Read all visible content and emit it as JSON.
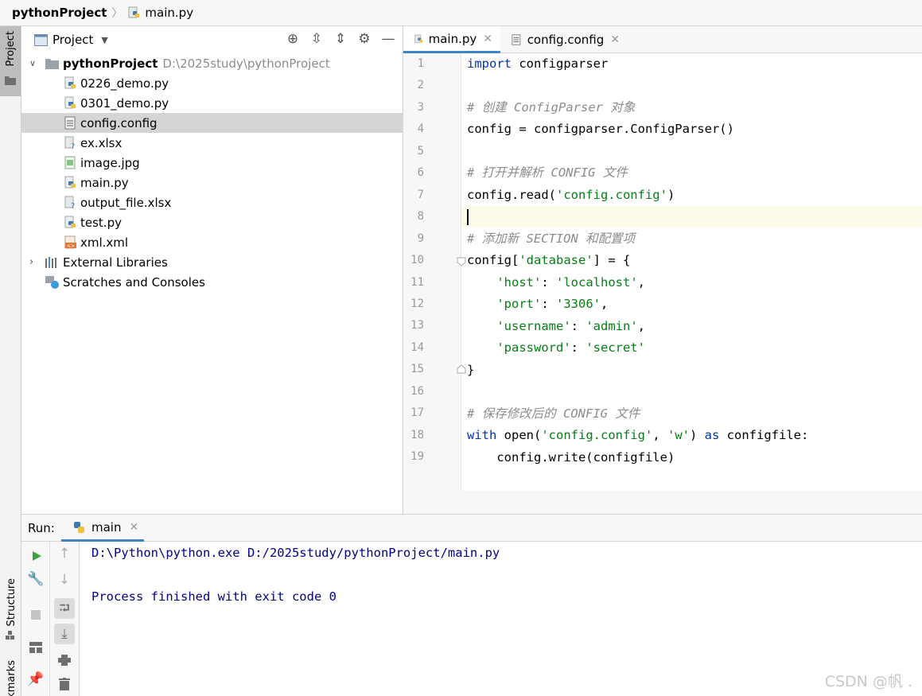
{
  "breadcrumb": {
    "project": "pythonProject",
    "file": "main.py"
  },
  "tool_windows": {
    "project": "Project",
    "structure": "Structure",
    "bookmarks": "kmarks"
  },
  "project_panel": {
    "title": "Project",
    "root": {
      "name": "pythonProject",
      "path": "D:\\2025study\\pythonProject"
    },
    "files": [
      {
        "name": "0226_demo.py",
        "type": "python"
      },
      {
        "name": "0301_demo.py",
        "type": "python"
      },
      {
        "name": "config.config",
        "type": "text",
        "selected": true
      },
      {
        "name": "ex.xlsx",
        "type": "unknown"
      },
      {
        "name": "image.jpg",
        "type": "image"
      },
      {
        "name": "main.py",
        "type": "python"
      },
      {
        "name": "output_file.xlsx",
        "type": "unknown"
      },
      {
        "name": "test.py",
        "type": "python"
      },
      {
        "name": "xml.xml",
        "type": "xml"
      }
    ],
    "external_libraries": "External Libraries",
    "scratches": "Scratches and Consoles"
  },
  "editor": {
    "tabs": [
      {
        "label": "main.py",
        "active": true
      },
      {
        "label": "config.config",
        "active": false
      }
    ],
    "line_numbers": [
      "1",
      "2",
      "3",
      "4",
      "5",
      "6",
      "7",
      "8",
      "9",
      "10",
      "11",
      "12",
      "13",
      "14",
      "15",
      "16",
      "17",
      "18",
      "19"
    ],
    "code": {
      "l1_kw": "import",
      "l1_rest": " configparser",
      "l3": "# 创建 ConfigParser 对象",
      "l4": "config = configparser.ConfigParser()",
      "l6": "# 打开并解析 CONFIG 文件",
      "l7_a": "config.read(",
      "l7_s": "'config.config'",
      "l7_b": ")",
      "l9": "# 添加新 SECTION 和配置项",
      "l10_a": "config[",
      "l10_s": "'database'",
      "l10_b": "] = {",
      "l11_k": "'host'",
      "l11_sep": ": ",
      "l11_v": "'localhost'",
      "l11_end": ",",
      "l12_k": "'port'",
      "l12_sep": ": ",
      "l12_v": "'3306'",
      "l12_end": ",",
      "l13_k": "'username'",
      "l13_sep": ": ",
      "l13_v": "'admin'",
      "l13_end": ",",
      "l14_k": "'password'",
      "l14_sep": ": ",
      "l14_v": "'secret'",
      "l15": "}",
      "l17": "# 保存修改后的 CONFIG 文件",
      "l18_kw1": "with",
      "l18_a": " open(",
      "l18_s1": "'config.config'",
      "l18_b": ", ",
      "l18_s2": "'w'",
      "l18_c": ") ",
      "l18_kw2": "as",
      "l18_d": " configfile:",
      "l19": "    config.write(configfile)"
    }
  },
  "run_panel": {
    "label": "Run:",
    "tab": "main",
    "output": [
      "D:\\Python\\python.exe D:/2025study/pythonProject/main.py",
      "",
      "Process finished with exit code 0"
    ]
  },
  "watermark": "CSDN @帆 .",
  "colors": {
    "keyword": "#0033b3",
    "string": "#067d17",
    "comment": "#8c8c8c",
    "accent": "#4083c9",
    "console": "#00008b"
  }
}
